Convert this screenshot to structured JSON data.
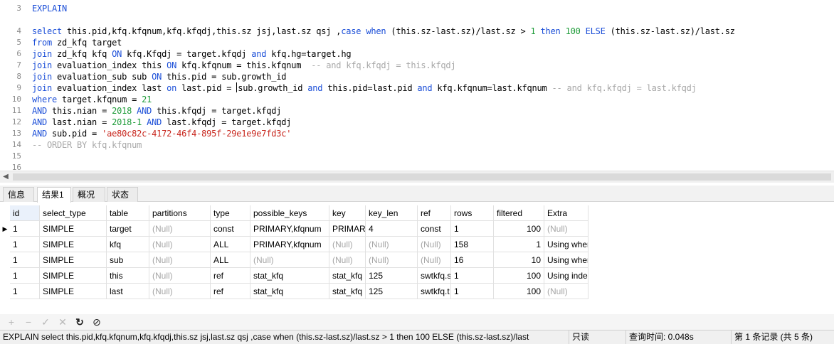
{
  "editor": {
    "lines": [
      {
        "n": "3",
        "tokens": [
          {
            "t": "EXPLAIN",
            "c": "kw"
          }
        ]
      },
      {
        "n": "",
        "tokens": []
      },
      {
        "n": "4",
        "tokens": [
          {
            "t": "select",
            "c": "kw"
          },
          {
            "t": " this.pid,kfq.kfqnum,kfq.kfqdj,this.sz jsj,last.sz qsj ,",
            "c": ""
          },
          {
            "t": "case",
            "c": "kw"
          },
          {
            "t": " ",
            "c": ""
          },
          {
            "t": "when",
            "c": "kw"
          },
          {
            "t": " (this.sz-last.sz)/last.sz > ",
            "c": ""
          },
          {
            "t": "1",
            "c": "num"
          },
          {
            "t": " ",
            "c": ""
          },
          {
            "t": "then",
            "c": "kw"
          },
          {
            "t": " ",
            "c": ""
          },
          {
            "t": "100",
            "c": "num"
          },
          {
            "t": " ",
            "c": ""
          },
          {
            "t": "ELSE",
            "c": "kw"
          },
          {
            "t": " (this.sz-last.sz)/last.sz",
            "c": ""
          }
        ]
      },
      {
        "n": "5",
        "tokens": [
          {
            "t": "from",
            "c": "kw"
          },
          {
            "t": " zd_kfq target",
            "c": ""
          }
        ]
      },
      {
        "n": "6",
        "tokens": [
          {
            "t": "join",
            "c": "kw"
          },
          {
            "t": " zd_kfq kfq ",
            "c": ""
          },
          {
            "t": "ON",
            "c": "kw"
          },
          {
            "t": " kfq.Kfqdj = target.kfqdj ",
            "c": ""
          },
          {
            "t": "and",
            "c": "kw"
          },
          {
            "t": " kfq.hg=target.hg",
            "c": ""
          }
        ]
      },
      {
        "n": "7",
        "tokens": [
          {
            "t": "join",
            "c": "kw"
          },
          {
            "t": " evaluation_index this ",
            "c": ""
          },
          {
            "t": "ON",
            "c": "kw"
          },
          {
            "t": " kfq.kfqnum = this.kfqnum  ",
            "c": ""
          },
          {
            "t": "-- and kfq.kfqdj = this.kfqdj",
            "c": "cmt"
          }
        ]
      },
      {
        "n": "8",
        "tokens": [
          {
            "t": "join",
            "c": "kw"
          },
          {
            "t": " evaluation_sub sub ",
            "c": ""
          },
          {
            "t": "ON",
            "c": "kw"
          },
          {
            "t": " this.pid = sub.growth_id",
            "c": ""
          }
        ]
      },
      {
        "n": "9",
        "tokens": [
          {
            "t": "join",
            "c": "kw"
          },
          {
            "t": " evaluation_index last ",
            "c": ""
          },
          {
            "t": "on",
            "c": "kw"
          },
          {
            "t": " last.pid = ",
            "c": ""
          },
          {
            "t": "|",
            "c": "caret"
          },
          {
            "t": "sub.growth_id ",
            "c": ""
          },
          {
            "t": "and",
            "c": "kw"
          },
          {
            "t": " this.pid=last.pid ",
            "c": ""
          },
          {
            "t": "and",
            "c": "kw"
          },
          {
            "t": " kfq.kfqnum=last.kfqnum ",
            "c": ""
          },
          {
            "t": "-- and kfq.kfqdj = last.kfqdj",
            "c": "cmt"
          }
        ]
      },
      {
        "n": "10",
        "tokens": [
          {
            "t": "where",
            "c": "kw"
          },
          {
            "t": " target.kfqnum = ",
            "c": ""
          },
          {
            "t": "21",
            "c": "num"
          }
        ]
      },
      {
        "n": "11",
        "tokens": [
          {
            "t": "AND",
            "c": "kw"
          },
          {
            "t": " this.nian = ",
            "c": ""
          },
          {
            "t": "2018",
            "c": "num"
          },
          {
            "t": " ",
            "c": ""
          },
          {
            "t": "AND",
            "c": "kw"
          },
          {
            "t": " this.kfqdj = target.kfqdj",
            "c": ""
          }
        ]
      },
      {
        "n": "12",
        "tokens": [
          {
            "t": "AND",
            "c": "kw"
          },
          {
            "t": " last.nian = ",
            "c": ""
          },
          {
            "t": "2018-1",
            "c": "num"
          },
          {
            "t": " ",
            "c": ""
          },
          {
            "t": "AND",
            "c": "kw"
          },
          {
            "t": " last.kfqdj = target.kfqdj",
            "c": ""
          }
        ]
      },
      {
        "n": "13",
        "tokens": [
          {
            "t": "AND",
            "c": "kw"
          },
          {
            "t": " sub.pid = ",
            "c": ""
          },
          {
            "t": "'ae80c82c-4172-46f4-895f-29e1e9e7fd3c'",
            "c": "str"
          }
        ]
      },
      {
        "n": "14",
        "tokens": [
          {
            "t": "-- ORDER BY kfq.kfqnum",
            "c": "cmt"
          }
        ]
      },
      {
        "n": "15",
        "tokens": []
      },
      {
        "n": "16",
        "tokens": []
      }
    ],
    "scroll_arrow": "◀"
  },
  "tabs": [
    {
      "label": "信息",
      "active": false
    },
    {
      "label": "结果1",
      "active": true
    },
    {
      "label": "概况",
      "active": false
    },
    {
      "label": "状态",
      "active": false
    }
  ],
  "grid": {
    "columns": [
      "id",
      "select_type",
      "table",
      "partitions",
      "type",
      "possible_keys",
      "key",
      "key_len",
      "ref",
      "rows",
      "filtered",
      "Extra"
    ],
    "rows": [
      [
        "1",
        "SIMPLE",
        "target",
        "(Null)",
        "const",
        "PRIMARY,kfqnum",
        "PRIMARY",
        "4",
        "const",
        "1",
        "100",
        "(Null)"
      ],
      [
        "1",
        "SIMPLE",
        "kfq",
        "(Null)",
        "ALL",
        "PRIMARY,kfqnum",
        "(Null)",
        "(Null)",
        "(Null)",
        "158",
        "1",
        "Using where"
      ],
      [
        "1",
        "SIMPLE",
        "sub",
        "(Null)",
        "ALL",
        "(Null)",
        "(Null)",
        "(Null)",
        "(Null)",
        "16",
        "10",
        "Using where"
      ],
      [
        "1",
        "SIMPLE",
        "this",
        "(Null)",
        "ref",
        "stat_kfq",
        "stat_kfq",
        "125",
        "swtkfq.s",
        "1",
        "100",
        "Using index"
      ],
      [
        "1",
        "SIMPLE",
        "last",
        "(Null)",
        "ref",
        "stat_kfq",
        "stat_kfq",
        "125",
        "swtkfq.t",
        "1",
        "100",
        "(Null)"
      ]
    ],
    "current_row_marker": "▶"
  },
  "toolbar": {
    "add": "+",
    "remove": "−",
    "apply": "✓",
    "discard": "✕",
    "refresh": "↻",
    "stop": "⊘"
  },
  "status": {
    "query": "EXPLAIN  select this.pid,kfq.kfqnum,kfq.kfqdj,this.sz jsj,last.sz qsj ,case when (this.sz-last.sz)/last.sz > 1 then 100 ELSE (this.sz-last.sz)/last",
    "readonly": "只读",
    "time": "查询时间: 0.048s",
    "records": "第 1 条记录 (共 5 条)"
  },
  "colors": {
    "keyword": "#1c4fd8",
    "number": "#1f9c3a",
    "string": "#c8261d",
    "comment": "#a8a8a8",
    "null": "#a6a6a6"
  }
}
